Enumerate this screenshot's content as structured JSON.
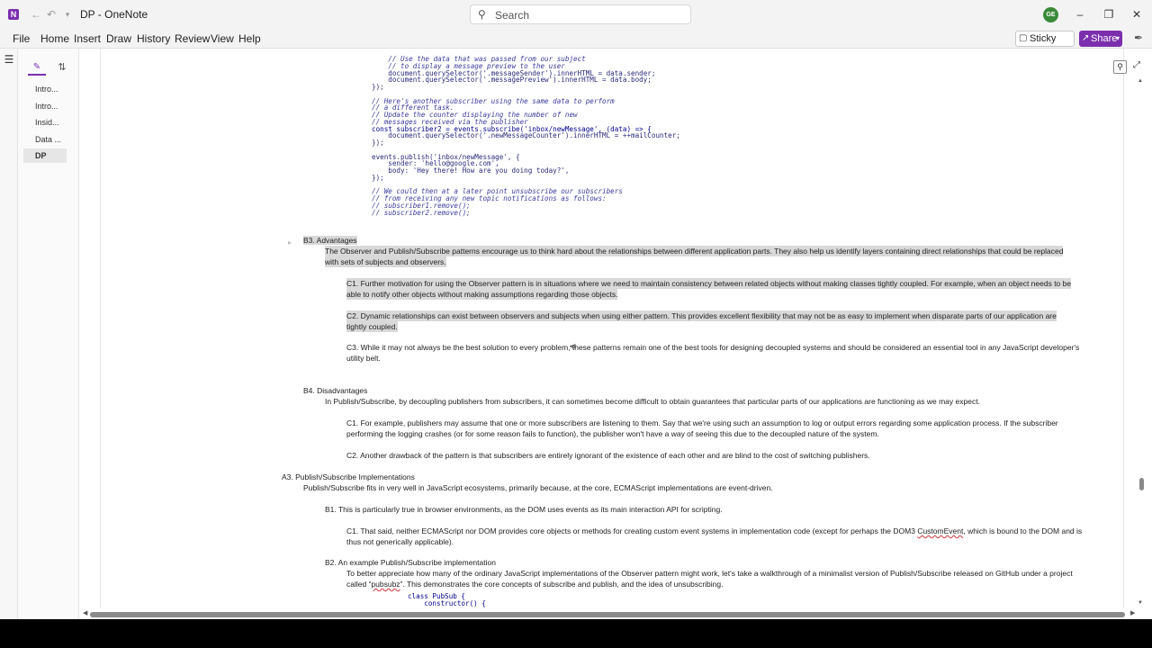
{
  "window": {
    "title": "DP  -  OneNote",
    "search_placeholder": "Search",
    "avatar_initials": "GE",
    "icons": {
      "app": "onenote-icon",
      "back": "back-arrow-icon",
      "forward": "forward-arrow-icon",
      "undo": "undo-icon",
      "more": "quick-access-dropdown-icon"
    }
  },
  "menu": {
    "items": [
      "File",
      "Home",
      "Insert",
      "Draw",
      "History",
      "Review",
      "View",
      "Help"
    ],
    "sticky_notes": "Sticky Notes",
    "share": "Share"
  },
  "pages": [
    "Intro...",
    "Intro...",
    "Insid...",
    "Data ...",
    "DP"
  ],
  "code_top": [
    "    // Use the data that was passed from our subject",
    "    // to display a message preview to the user",
    "    document.querySelector('.messageSender').innerHTML = data.sender;",
    "    document.querySelector('.messagePreview').innerHTML = data.body;",
    "});",
    "",
    "// Here's another subscriber using the same data to perform",
    "// a different task.",
    "// Update the counter displaying the number of new",
    "// messages received via the publisher",
    "const subscriber2 = events.subscribe('inbox/newMessage', (data) => {",
    "    document.querySelector('.newMessageCounter').innerHTML = ++mailCounter;",
    "});",
    "",
    "events.publish('inbox/newMessage', {",
    "    sender: 'hello@google.com',",
    "    body: 'Hey there! How are you doing today?',",
    "});",
    "",
    "// We could then at a later point unsubscribe our subscribers",
    "// from receiving any new topic notifications as follows:",
    "// subscriber1.remove();",
    "// subscriber2.remove();"
  ],
  "notes": {
    "b3_heading": "B3. Advantages",
    "b3_para_1": "The Observer and Publish/Subscribe patterns encourage us to think hard about the relationships between different application parts. They also help us identify layers containing direct relationships that could be replaced",
    "b3_para_2": "with sets of subjects and observers.",
    "b3_c1_1": "C1. Further motivation for using the Observer pattern is in situations where we need to maintain consistency between related objects without making classes tightly coupled. For example, when an object needs to be",
    "b3_c1_2": "able to notify other objects without making assumptions regarding those objects.",
    "b3_c2_1": "C2. Dynamic relationships can exist between observers and subjects when using either pattern. This provides excellent flexibility that may not be as easy to implement when disparate parts of our application are",
    "b3_c2_2": "tightly coupled.",
    "b3_c3_1": "C3. While it may not always be the best solution to every problem, these patterns remain one of the best tools for designing decoupled systems and should be considered an essential tool in any JavaScript developer's",
    "b3_c3_2": "utility belt.",
    "b4_heading": "B4. Disadvantages",
    "b4_para": "In Publish/Subscribe, by decoupling publishers from subscribers, it can sometimes become difficult to obtain guarantees that particular parts of our applications are functioning as we may expect.",
    "b4_c1_1": "C1. For example, publishers may assume that one or more subscribers are listening to them. Say that we're using such an assumption to log or output errors regarding some application process. If the subscriber",
    "b4_c1_2": "performing the logging crashes (or for some reason fails to function), the publisher won't have a way of seeing this due to the decoupled nature of the system.",
    "b4_c2": "C2. Another drawback of the pattern is that subscribers are entirely ignorant of the existence of each other and are blind to the cost of switching publishers.",
    "a3_heading": "A3. Publish/Subscribe Implementations",
    "a3_para": "Publish/Subscribe fits in very well in JavaScript ecosystems, primarily because, at the core, ECMAScript implementations are event-driven.",
    "a3_b1": "B1. This is particularly true in browser environments, as the DOM uses events as its main interaction API for scripting.",
    "a3_b1_c1_pre": "C1. That said, neither ECMAScript nor DOM provides core objects or methods for creating custom event systems in implementation code (except for perhaps the DOM3 ",
    "a3_b1_c1_spell": "CustomEvent",
    "a3_b1_c1_post": ", which is bound to the DOM and is",
    "a3_b1_c1_2": "thus not generically applicable).",
    "a3_b2": "B2. An example Publish/Subscribe implementation",
    "a3_b2_para_1": "To better appreciate how many of the ordinary JavaScript implementations of the Observer pattern might work, let's take a walkthrough of a minimalist version of Publish/Subscribe released on GitHub under a project",
    "a3_b2_para_2_pre": "called “",
    "a3_b2_para_2_spell": "pubsubz",
    "a3_b2_para_2_post": "”. This demonstrates the core concepts of subscribe and publish, and the idea of unsubscribing."
  },
  "code_bottom": [
    "class PubSub {",
    "    constructor() {"
  ]
}
